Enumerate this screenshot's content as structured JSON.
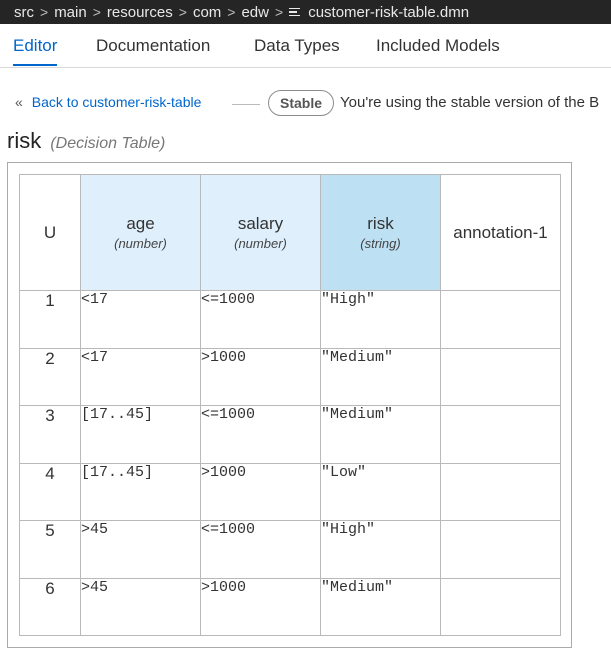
{
  "breadcrumb": {
    "items": [
      "src",
      "main",
      "resources",
      "com",
      "edw"
    ],
    "file_name": "customer-risk-table.dmn"
  },
  "tabs": [
    "Editor",
    "Documentation",
    "Data Types",
    "Included Models"
  ],
  "back_link": {
    "chevron": "«",
    "label": "Back to customer-risk-table"
  },
  "version_badge": "Stable",
  "version_message": "You're using the stable version of the B",
  "decision": {
    "name": "risk",
    "kind": "(Decision Table)"
  },
  "table": {
    "hit_policy": "U",
    "inputs": [
      {
        "name": "age",
        "type": "(number)"
      },
      {
        "name": "salary",
        "type": "(number)"
      }
    ],
    "output": {
      "name": "risk",
      "type": "(string)"
    },
    "annotation": "annotation-1",
    "rows": [
      {
        "num": "1",
        "age": "<17",
        "salary": "<=1000",
        "risk": "\"High\"",
        "annotation": ""
      },
      {
        "num": "2",
        "age": "<17",
        "salary": ">1000",
        "risk": "\"Medium\"",
        "annotation": ""
      },
      {
        "num": "3",
        "age": "[17..45]",
        "salary": "<=1000",
        "risk": "\"Medium\"",
        "annotation": ""
      },
      {
        "num": "4",
        "age": "[17..45]",
        "salary": ">1000",
        "risk": "\"Low\"",
        "annotation": ""
      },
      {
        "num": "5",
        "age": ">45",
        "salary": "<=1000",
        "risk": "\"High\"",
        "annotation": ""
      },
      {
        "num": "6",
        "age": ">45",
        "salary": ">1000",
        "risk": "\"Medium\"",
        "annotation": ""
      }
    ]
  },
  "colors": {
    "accent": "#0066cc",
    "input_header": "#dff0fc",
    "output_header": "#bde0f3",
    "breadcrumb_bg": "#252526"
  }
}
